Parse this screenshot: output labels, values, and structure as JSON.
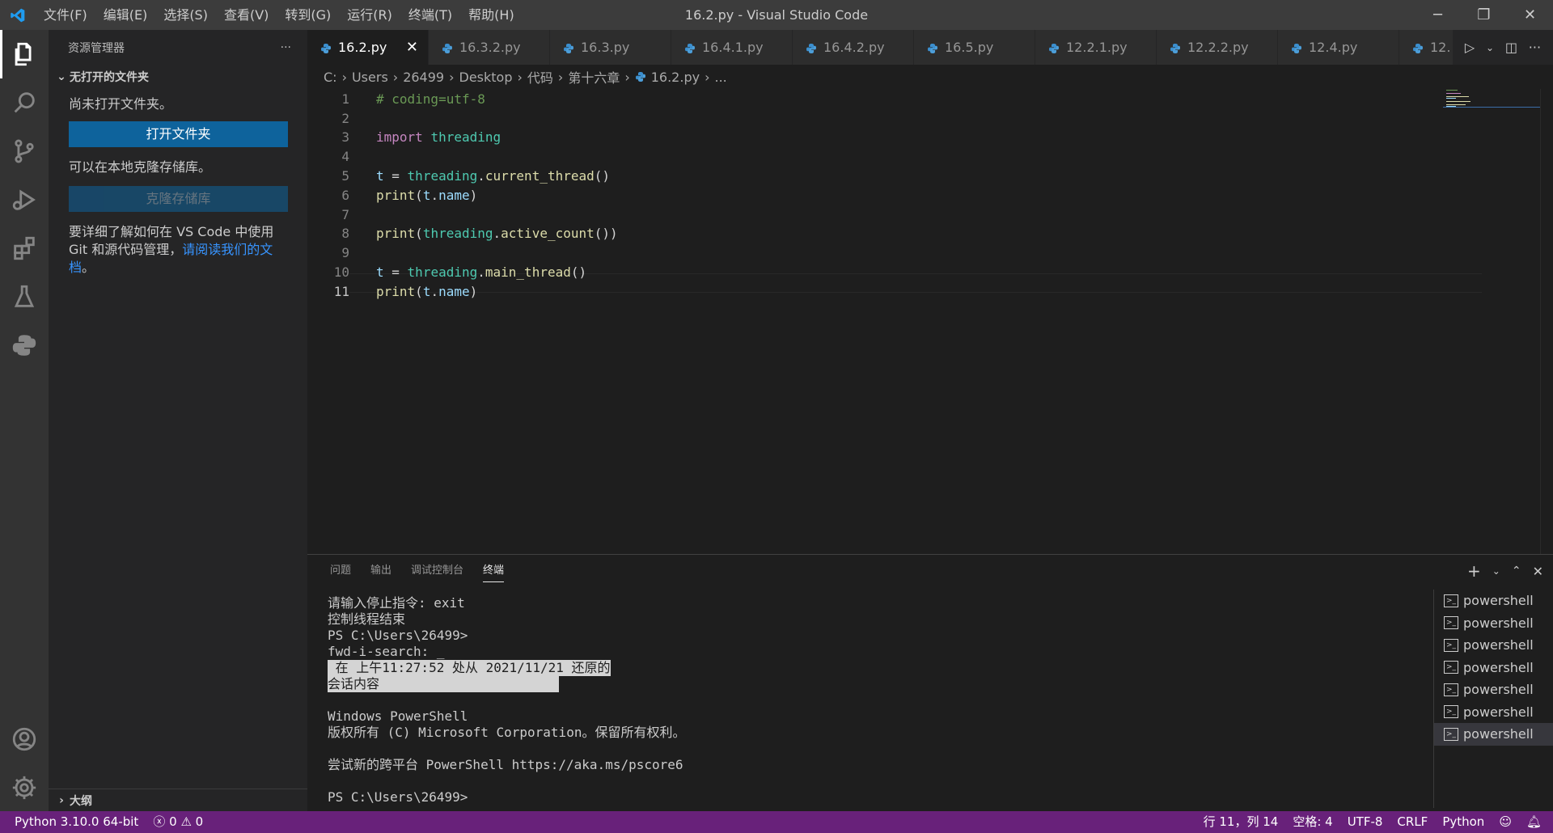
{
  "titlebar": {
    "title": "16.2.py - Visual Studio Code",
    "menu": [
      "文件(F)",
      "编辑(E)",
      "选择(S)",
      "查看(V)",
      "转到(G)",
      "运行(R)",
      "终端(T)",
      "帮助(H)"
    ],
    "minimize": "─",
    "restore": "❐",
    "close": "✕"
  },
  "sidebar": {
    "header": "资源管理器",
    "more": "···",
    "section": "无打开的文件夹",
    "no_folder_text": "尚未打开文件夹。",
    "open_folder_button": "打开文件夹",
    "clone_text": "可以在本地克隆存储库。",
    "clone_button": "克隆存储库",
    "learn_text": "要详细了解如何在 VS Code 中使用 Git 和源代码管理，",
    "learn_link": "请阅读我们的文档",
    "learn_end": "。",
    "outline": "大纲"
  },
  "tabs": [
    {
      "label": "16.2.py",
      "active": true
    },
    {
      "label": "16.3.2.py"
    },
    {
      "label": "16.3.py"
    },
    {
      "label": "16.4.1.py"
    },
    {
      "label": "16.4.2.py"
    },
    {
      "label": "16.5.py"
    },
    {
      "label": "12.2.1.py"
    },
    {
      "label": "12.2.2.py"
    },
    {
      "label": "12.4.py"
    },
    {
      "label": "12."
    }
  ],
  "breadcrumb": [
    "C:",
    "Users",
    "26499",
    "Desktop",
    "代码",
    "第十六章",
    "16.2.py",
    "..."
  ],
  "editor": {
    "current_line": 11,
    "lines": [
      {
        "n": "1"
      },
      {
        "n": "2"
      },
      {
        "n": "3"
      },
      {
        "n": "4"
      },
      {
        "n": "5"
      },
      {
        "n": "6"
      },
      {
        "n": "7"
      },
      {
        "n": "8"
      },
      {
        "n": "9"
      },
      {
        "n": "10"
      },
      {
        "n": "11"
      }
    ],
    "code": {
      "l1": "# coding=utf-8",
      "l3_kw": "import",
      "l3_mod": "threading",
      "l5_var": "t",
      "l5_eq": " = ",
      "l5_mod": "threading",
      "l5_dot": ".",
      "l5_fn": "current_thread",
      "l5_end": "()",
      "l6_fn": "print",
      "l6_open": "(",
      "l6_var": "t",
      "l6_dot": ".",
      "l6_attr": "name",
      "l6_close": ")",
      "l8_fn": "print",
      "l8_open": "(",
      "l8_mod": "threading",
      "l8_dot": ".",
      "l8_fn2": "active_count",
      "l8_close": "())",
      "l10_var": "t",
      "l10_eq": " = ",
      "l10_mod": "threading",
      "l10_dot": ".",
      "l10_fn": "main_thread",
      "l10_end": "()",
      "l11_fn": "print",
      "l11_open": "(",
      "l11_var": "t",
      "l11_dot": ".",
      "l11_attr": "name",
      "l11_close": ")"
    }
  },
  "panel": {
    "tabs": [
      "问题",
      "输出",
      "调试控制台",
      "终端"
    ],
    "active_tab": "终端",
    "terminal_lines": [
      "请输入停止指令: exit",
      "控制线程结束",
      "PS C:\\Users\\26499>",
      "fwd-i-search: _",
      " 在 上午11:27:52 处从 2021/11/21 还原的",
      "会话内容",
      "",
      "Windows PowerShell",
      "版权所有 (C) Microsoft Corporation。保留所有权利。",
      "",
      "尝试新的跨平台 PowerShell https://aka.ms/pscore6",
      "",
      "PS C:\\Users\\26499>"
    ],
    "terminals": [
      "powershell",
      "powershell",
      "powershell",
      "powershell",
      "powershell",
      "powershell",
      "powershell"
    ]
  },
  "statusbar": {
    "python": "Python 3.10.0 64-bit",
    "errors": "0",
    "warnings": "0",
    "position": "行 11，列 14",
    "spaces": "空格: 4",
    "encoding": "UTF-8",
    "eol": "CRLF",
    "language": "Python"
  },
  "colors": {
    "statusbar": "#68217a",
    "accent": "#0e639c",
    "link": "#3794ff"
  }
}
